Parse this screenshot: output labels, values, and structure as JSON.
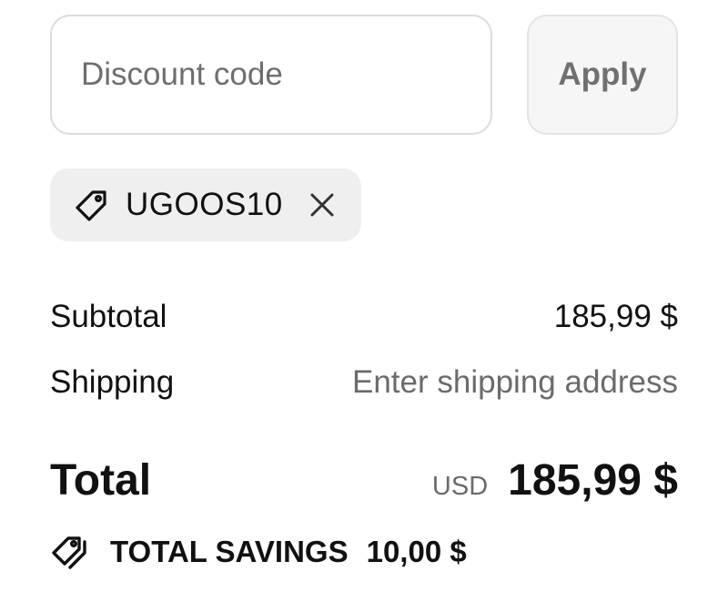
{
  "discount": {
    "input_value": "",
    "placeholder": "Discount code",
    "apply_label": "Apply"
  },
  "applied_code": {
    "icon": "tag-icon",
    "code": "UGOOS10",
    "remove_icon": "close-icon"
  },
  "summary": {
    "subtotal_label": "Subtotal",
    "subtotal_value": "185,99 $",
    "shipping_label": "Shipping",
    "shipping_value": "Enter shipping address",
    "total_label": "Total",
    "currency": "USD",
    "total_value": "185,99 $"
  },
  "savings": {
    "icon": "tags-icon",
    "label": "TOTAL SAVINGS",
    "amount": "10,00 $"
  },
  "colors": {
    "text": "#111111",
    "muted_text": "#6b6b6b",
    "chip_background": "#efefef",
    "input_border": "#dcdcdc",
    "button_background": "#f6f6f6"
  }
}
